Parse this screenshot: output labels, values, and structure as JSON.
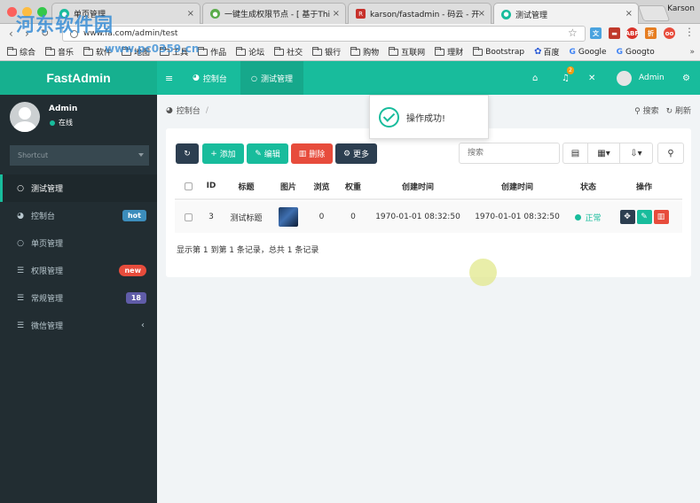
{
  "browser": {
    "tabs": [
      {
        "title": "单页管理",
        "fav_color": "#18bc9c"
      },
      {
        "title": "一键生成权限节点 - [ 基于Thi",
        "fav_color": "#5aab4a"
      },
      {
        "title": "karson/fastadmin - 码云 - 开",
        "fav_color": "#c7312b"
      },
      {
        "title": "测试管理",
        "fav_color": "#18bc9c"
      }
    ],
    "profile": "Karson",
    "url": "www.fa.com/admin/test",
    "watermark": "河东软件园",
    "watermark_url": "www.pc0359.cn",
    "bookmarks": [
      "综合",
      "音乐",
      "软件",
      "地图",
      "工具",
      "作品",
      "论坛",
      "社交",
      "银行",
      "购物",
      "互联网",
      "理财",
      "Bootstrap",
      "百度",
      "Google",
      "Googto"
    ],
    "ext_labels": [
      "ABP",
      "折",
      "oo"
    ]
  },
  "app": {
    "logo": "FastAdmin",
    "topnav": {
      "tab1": "控制台",
      "tab2": "测试管理",
      "notif_count": "2",
      "admin": "Admin"
    },
    "user": {
      "name": "Admin",
      "status": "在线"
    },
    "shortcut_placeholder": "Shortcut",
    "menu": [
      {
        "label": "测试管理"
      },
      {
        "label": "控制台",
        "badge": "hot",
        "badge_color": "#3c8dbc"
      },
      {
        "label": "单页管理"
      },
      {
        "label": "权限管理",
        "badge": "new",
        "badge_color": "#e74c3c"
      },
      {
        "label": "常规管理",
        "badge": "18",
        "badge_color": "#605ca8"
      },
      {
        "label": "微信管理"
      }
    ],
    "breadcrumb": "控制台",
    "crumb_actions": {
      "search": "搜索",
      "refresh": "刷新"
    },
    "toast": "操作成功!",
    "toolbar": {
      "add": "添加",
      "edit": "编辑",
      "delete": "删除",
      "more": "更多",
      "search_placeholder": "搜索"
    },
    "table": {
      "headers": [
        "ID",
        "标题",
        "图片",
        "浏览",
        "权重",
        "创建时间",
        "创建时间",
        "状态",
        "操作"
      ],
      "rows": [
        {
          "id": "3",
          "title": "测试标题",
          "views": "0",
          "weight": "0",
          "created": "1970-01-01 08:32:50",
          "created2": "1970-01-01 08:32:50",
          "status": "正常"
        }
      ]
    },
    "summary": "显示第 1 到第 1 条记录，总共 1 条记录"
  }
}
